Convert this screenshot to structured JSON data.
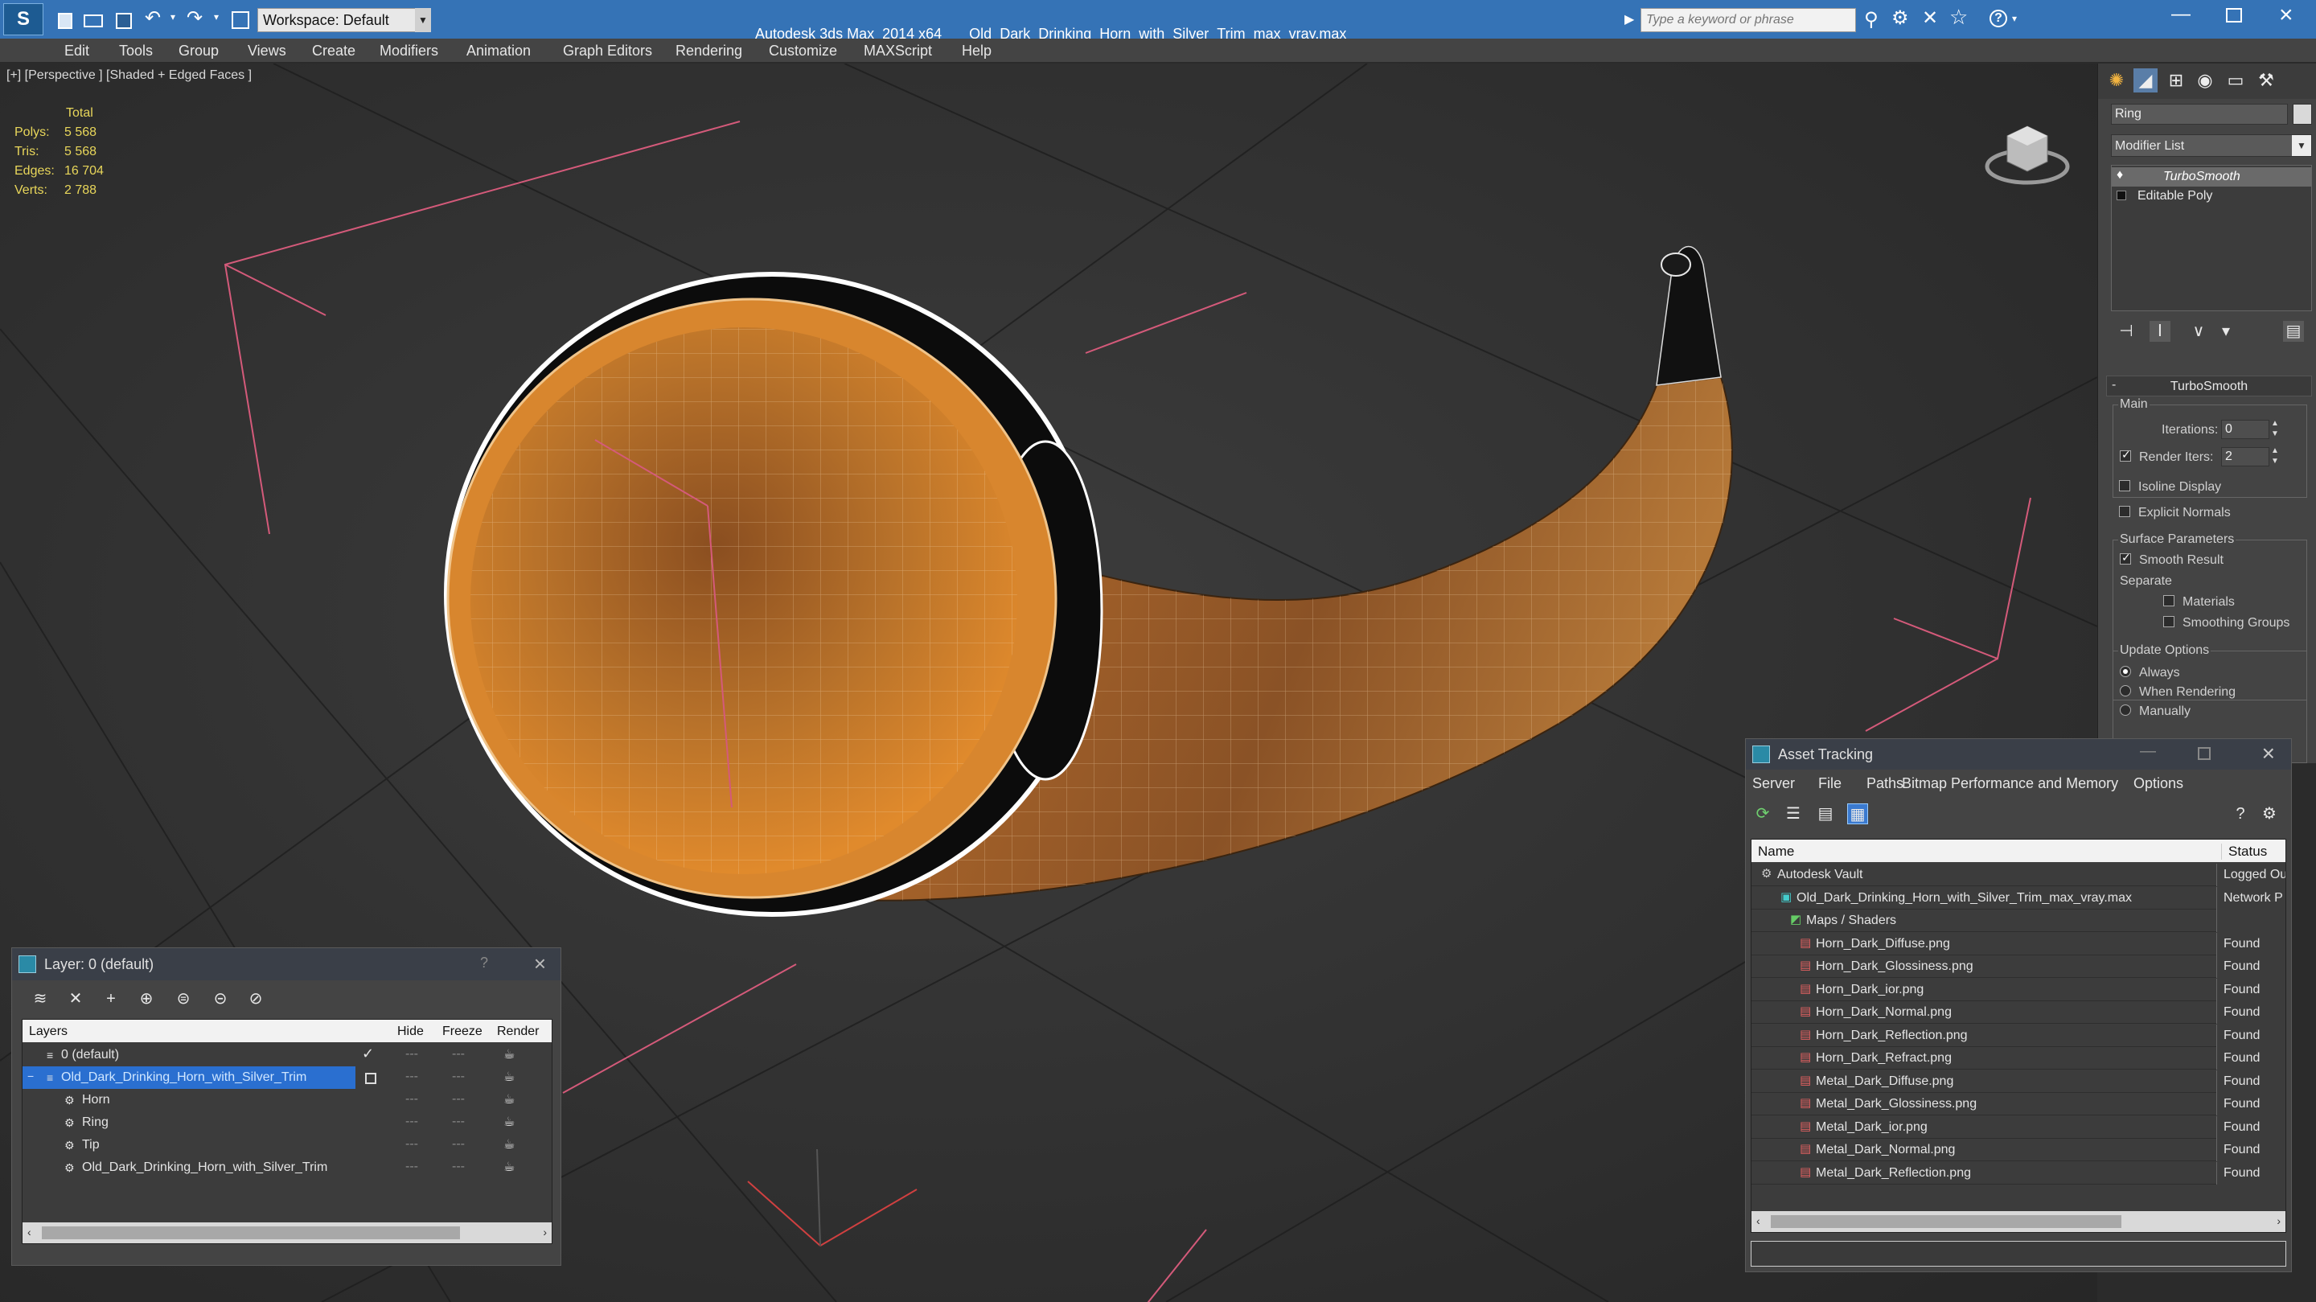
{
  "titlebar": {
    "app": "Autodesk 3ds Max  2014 x64",
    "file": "Old_Dark_Drinking_Horn_with_Silver_Trim_max_vray.max",
    "workspace": "Workspace: Default",
    "search_placeholder": "Type a keyword or phrase"
  },
  "menu": [
    "Edit",
    "Tools",
    "Group",
    "Views",
    "Create",
    "Modifiers",
    "Animation",
    "Graph Editors",
    "Rendering",
    "Customize",
    "MAXScript",
    "Help"
  ],
  "viewport": {
    "label": "[+] [Perspective ] [Shaded + Edged Faces ]",
    "stats": {
      "header": "Total",
      "polys_label": "Polys:",
      "polys": "5 568",
      "tris_label": "Tris:",
      "tris": "5 568",
      "edges_label": "Edges:",
      "edges": "16 704",
      "verts_label": "Verts:",
      "verts": "2 788"
    }
  },
  "command_panel": {
    "object_name": "Ring",
    "modifier_list": "Modifier List",
    "stack": [
      "TurboSmooth",
      "Editable Poly"
    ],
    "rollout_title": "TurboSmooth",
    "main_label": "Main",
    "iterations_label": "Iterations:",
    "iterations": "0",
    "render_iters_label": "Render Iters:",
    "render_iters": "2",
    "isoline": "Isoline Display",
    "explicit_normals": "Explicit Normals",
    "surface_params": "Surface Parameters",
    "smooth_result": "Smooth Result",
    "separate": "Separate",
    "materials": "Materials",
    "smoothing_groups": "Smoothing Groups",
    "update_options": "Update Options",
    "always": "Always",
    "when_rendering": "When Rendering",
    "manually": "Manually"
  },
  "layer_window": {
    "title": "Layer: 0 (default)",
    "help": "?",
    "columns": [
      "Layers",
      "Hide",
      "Freeze",
      "Render"
    ],
    "rows": [
      {
        "name": "0 (default)"
      },
      {
        "name": "Old_Dark_Drinking_Horn_with_Silver_Trim"
      },
      {
        "name": "Horn"
      },
      {
        "name": "Ring"
      },
      {
        "name": "Tip"
      },
      {
        "name": "Old_Dark_Drinking_Horn_with_Silver_Trim"
      }
    ]
  },
  "asset_window": {
    "title": "Asset Tracking",
    "menu": [
      "Server",
      "File",
      "Paths",
      "Bitmap Performance and Memory",
      "Options"
    ],
    "columns": [
      "Name",
      "Status"
    ],
    "rows": [
      {
        "name": "Autodesk Vault",
        "status": "Logged Ou"
      },
      {
        "name": "Old_Dark_Drinking_Horn_with_Silver_Trim_max_vray.max",
        "status": "Network P"
      },
      {
        "name": "Maps / Shaders",
        "status": ""
      },
      {
        "name": "Horn_Dark_Diffuse.png",
        "status": "Found"
      },
      {
        "name": "Horn_Dark_Glossiness.png",
        "status": "Found"
      },
      {
        "name": "Horn_Dark_ior.png",
        "status": "Found"
      },
      {
        "name": "Horn_Dark_Normal.png",
        "status": "Found"
      },
      {
        "name": "Horn_Dark_Reflection.png",
        "status": "Found"
      },
      {
        "name": "Horn_Dark_Refract.png",
        "status": "Found"
      },
      {
        "name": "Metal_Dark_Diffuse.png",
        "status": "Found"
      },
      {
        "name": "Metal_Dark_Glossiness.png",
        "status": "Found"
      },
      {
        "name": "Metal_Dark_ior.png",
        "status": "Found"
      },
      {
        "name": "Metal_Dark_Normal.png",
        "status": "Found"
      },
      {
        "name": "Metal_Dark_Reflection.png",
        "status": "Found"
      }
    ]
  },
  "colors": {
    "titlebar": "#3573b6",
    "selection": "#2a6fd0",
    "stats": "#e8d65a",
    "horn": "#c97a2a"
  }
}
